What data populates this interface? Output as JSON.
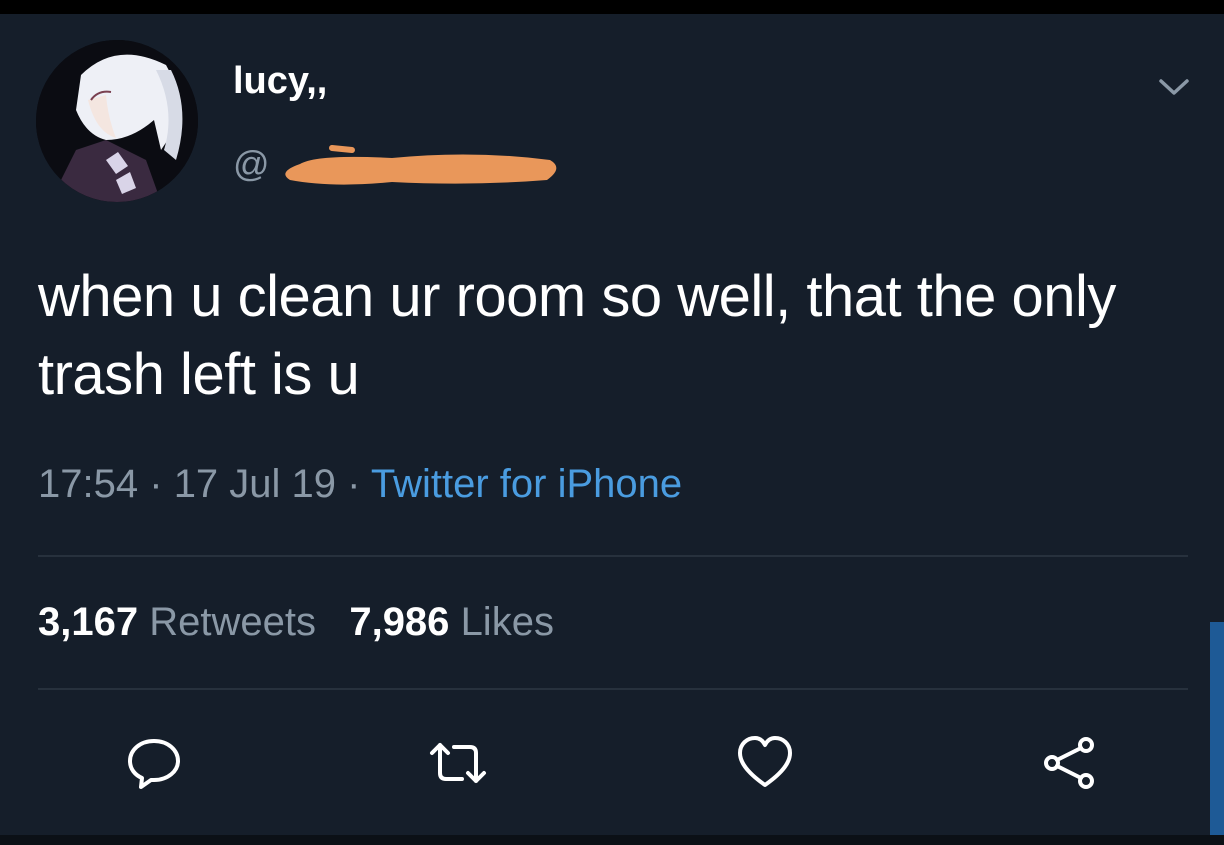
{
  "user": {
    "display_name": "lucy,,",
    "handle_prefix": "@"
  },
  "tweet": {
    "text": "when u clean ur room so well, that the only trash left is u",
    "time": "17:54",
    "date": "17 Jul 19",
    "separator": "·",
    "source": "Twitter for iPhone"
  },
  "stats": {
    "retweets_count": "3,167",
    "retweets_label": "Retweets",
    "likes_count": "7,986",
    "likes_label": "Likes"
  },
  "icons": {
    "avatar": "avatar",
    "menu": "chevron-down-icon",
    "reply": "reply-icon",
    "retweet": "retweet-icon",
    "like": "heart-icon",
    "share": "share-icon"
  },
  "colors": {
    "background": "#151e2a",
    "text": "#ffffff",
    "secondary_text": "#8a98a6",
    "link": "#4a9ce0",
    "redaction": "#e9975a"
  }
}
